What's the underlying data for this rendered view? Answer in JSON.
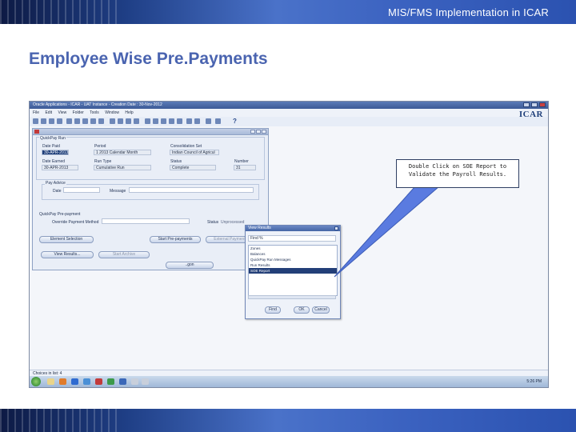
{
  "slide": {
    "header_title": "MIS/FMS Implementation in ICAR",
    "page_title": "Employee Wise Pre.Payments"
  },
  "app": {
    "window_title": "Oracle Applications - ICAR - UAT Instance - Creation Date : 30-Nov-2012",
    "menu": [
      "File",
      "Edit",
      "View",
      "Folder",
      "Tools",
      "Window",
      "Help"
    ],
    "help_glyph": "?",
    "logo": "ICAR",
    "status_text": "Choices in list: 4"
  },
  "form": {
    "window_title": "",
    "quickpay_run": {
      "section_label": "QuickPay Run",
      "date_paid_label": "Date Paid",
      "date_paid_value": "30-APR-2013",
      "period_label": "Period",
      "period_value": "1 2013 Calendar Month",
      "consolidation_label": "Consolidation Set",
      "consolidation_value": "Indian Council of Agricul",
      "date_earned_label": "Date Earned",
      "date_earned_value": "30-APR-2013",
      "run_type_label": "Run Type",
      "run_type_value": "Cumulative Run",
      "status_label": "Status",
      "status_value": "Complete",
      "number_label": "Number",
      "number_value": "31"
    },
    "pay_advice": {
      "section_label": "Pay Advice",
      "date_label": "Date",
      "message_label": "Message"
    },
    "prepayment": {
      "section_label": "QuickPay Pre-payment",
      "override_label": "Override Payment Method",
      "status_label": "Status",
      "status_value": "Unprocessed"
    },
    "buttons": {
      "element_selection": "Element Selection",
      "start_prepayments": "Start Pre-payments",
      "external_payment": "External Payment",
      "view_results": "View Results...",
      "start_archive": "Start Archive",
      "partial_button": "..gon"
    }
  },
  "dialog": {
    "title": "View Results",
    "find_value": "Find %",
    "items": [
      "Zones",
      "Balances",
      "QuickPay Run Messages",
      "Run Results",
      "SOE Report"
    ],
    "selected_index": 4,
    "buttons": {
      "find": "Find",
      "ok": "OK",
      "cancel": "Cancel"
    }
  },
  "taskbar": {
    "clock": "5:26 PM"
  },
  "callout": {
    "text": "Double Click on SOE Report to Validate the Payroll Results."
  },
  "colors": {
    "title_blue": "#4a64b0",
    "band_dark": "#0d1a44",
    "band_light": "#4a72c9",
    "selection": "#233f78"
  }
}
